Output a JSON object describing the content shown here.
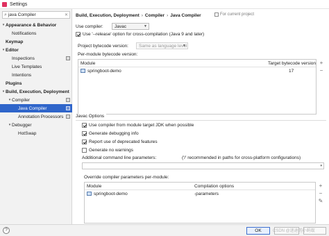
{
  "window": {
    "title": "Settings"
  },
  "search": {
    "value": "java Compiler",
    "clear_glyph": "✕"
  },
  "sidebar": {
    "items": [
      {
        "label": "Appearance & Behavior",
        "arrow": "▾",
        "bold": true,
        "indent": 0,
        "selected": false,
        "project": false
      },
      {
        "label": "Notifications",
        "arrow": "",
        "bold": false,
        "indent": 1,
        "selected": false,
        "project": false
      },
      {
        "label": "Keymap",
        "arrow": "",
        "bold": true,
        "indent": 0,
        "selected": false,
        "project": false
      },
      {
        "label": "Editor",
        "arrow": "▾",
        "bold": true,
        "indent": 0,
        "selected": false,
        "project": false
      },
      {
        "label": "Inspections",
        "arrow": "",
        "bold": false,
        "indent": 1,
        "selected": false,
        "project": true
      },
      {
        "label": "Live Templates",
        "arrow": "",
        "bold": false,
        "indent": 1,
        "selected": false,
        "project": false
      },
      {
        "label": "Intentions",
        "arrow": "",
        "bold": false,
        "indent": 1,
        "selected": false,
        "project": false
      },
      {
        "label": "Plugins",
        "arrow": "",
        "bold": true,
        "indent": 0,
        "selected": false,
        "project": false
      },
      {
        "label": "Build, Execution, Deployment",
        "arrow": "▾",
        "bold": true,
        "indent": 0,
        "selected": false,
        "project": false
      },
      {
        "label": "Compiler",
        "arrow": "▾",
        "bold": false,
        "indent": 1,
        "selected": false,
        "project": true
      },
      {
        "label": "Java Compiler",
        "arrow": "",
        "bold": false,
        "indent": 2,
        "selected": true,
        "project": true
      },
      {
        "label": "Annotation Processors",
        "arrow": "",
        "bold": false,
        "indent": 2,
        "selected": false,
        "project": true
      },
      {
        "label": "Debugger",
        "arrow": "▾",
        "bold": false,
        "indent": 1,
        "selected": false,
        "project": false
      },
      {
        "label": "HotSwap",
        "arrow": "",
        "bold": false,
        "indent": 2,
        "selected": false,
        "project": false
      }
    ]
  },
  "breadcrumb": {
    "items": [
      "Build, Execution, Deployment",
      "Compiler",
      "Java Compiler"
    ],
    "separator": "›",
    "for_project": "For current project"
  },
  "compiler": {
    "label": "Use compiler:",
    "value": "Javac"
  },
  "release_option": {
    "label": "Use '--release' option for cross-compilation (Java 9 and later)",
    "checked": true
  },
  "bytecode": {
    "label": "Project bytecode version:",
    "value": "Same as language level"
  },
  "per_module": {
    "label": "Per-module bytecode version:",
    "columns": [
      "Module",
      "Target bytecode version"
    ],
    "rows": [
      {
        "module": "springboot-demo",
        "version": "17"
      }
    ]
  },
  "javac": {
    "title": "Javac Options",
    "options": [
      {
        "label": "Use compiler from module target JDK when possible",
        "checked": true
      },
      {
        "label": "Generate debugging info",
        "checked": true
      },
      {
        "label": "Report use of deprecated features",
        "checked": true
      },
      {
        "label": "Generate no warnings",
        "checked": false
      }
    ],
    "additional_label": "Additional command line parameters:",
    "additional_hint": "('/' recommended in paths for cross-platform configurations)",
    "additional_value": "",
    "override_label": "Override compiler parameters per-module:",
    "override_columns": [
      "Module",
      "Compilation options"
    ],
    "override_rows": [
      {
        "module": "springboot-demo",
        "options": "-parameters"
      }
    ]
  },
  "tools": {
    "add": "+",
    "remove": "−",
    "edit": "✎"
  },
  "footer": {
    "help": "?",
    "ok": "OK",
    "cancel": "Cancel",
    "apply": "Apply",
    "watermark": "CSDN @迷途的小蚂蚁"
  },
  "colors": {
    "selection": "#2f65ca",
    "accent": "#3d6fcf"
  },
  "icons": {
    "search": "search-icon",
    "module": "module-folder-icon",
    "project": "project-scope-icon"
  }
}
